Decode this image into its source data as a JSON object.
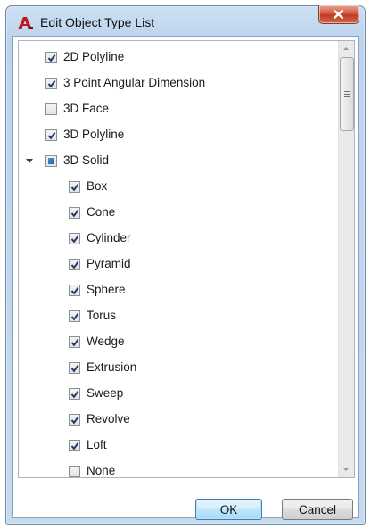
{
  "window": {
    "title": "Edit Object Type List"
  },
  "list": {
    "items": [
      {
        "label": "2D Polyline",
        "state": "checked",
        "level": 0
      },
      {
        "label": "3 Point Angular Dimension",
        "state": "checked",
        "level": 0
      },
      {
        "label": "3D Face",
        "state": "unchecked",
        "level": 0
      },
      {
        "label": "3D Polyline",
        "state": "checked",
        "level": 0
      },
      {
        "label": "3D Solid",
        "state": "partial",
        "level": 0,
        "expanded": true
      },
      {
        "label": "Box",
        "state": "checked",
        "level": 1
      },
      {
        "label": "Cone",
        "state": "checked",
        "level": 1
      },
      {
        "label": "Cylinder",
        "state": "checked",
        "level": 1
      },
      {
        "label": "Pyramid",
        "state": "checked",
        "level": 1
      },
      {
        "label": "Sphere",
        "state": "checked",
        "level": 1
      },
      {
        "label": "Torus",
        "state": "checked",
        "level": 1
      },
      {
        "label": "Wedge",
        "state": "checked",
        "level": 1
      },
      {
        "label": "Extrusion",
        "state": "checked",
        "level": 1
      },
      {
        "label": "Sweep",
        "state": "checked",
        "level": 1
      },
      {
        "label": "Revolve",
        "state": "checked",
        "level": 1
      },
      {
        "label": "Loft",
        "state": "checked",
        "level": 1
      },
      {
        "label": "None",
        "state": "unchecked",
        "level": 1
      }
    ]
  },
  "buttons": {
    "ok": "OK",
    "cancel": "Cancel"
  },
  "colors": {
    "accent": "#3c7fb1",
    "close": "#c7452b"
  }
}
